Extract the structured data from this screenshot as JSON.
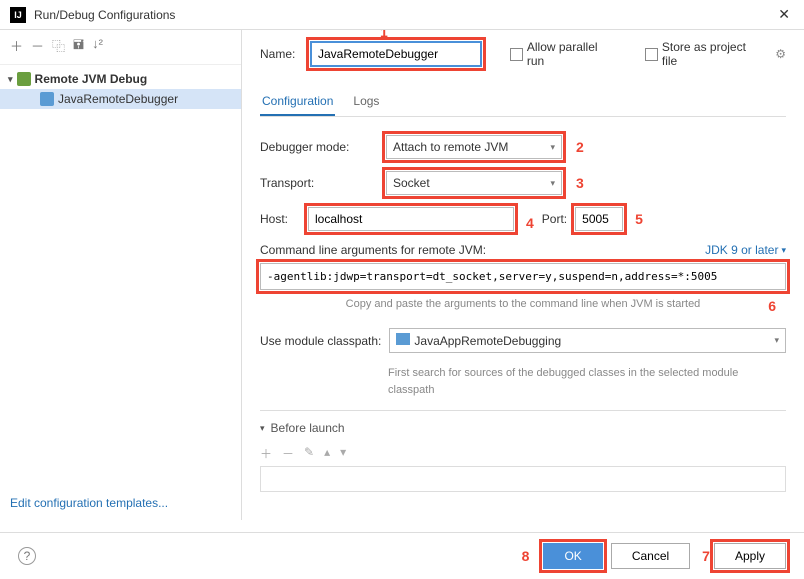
{
  "window": {
    "title": "Run/Debug Configurations"
  },
  "tree": {
    "root": "Remote JVM Debug",
    "child": "JavaRemoteDebugger"
  },
  "leftFooter": {
    "editTemplates": "Edit configuration templates..."
  },
  "form": {
    "nameLabel": "Name:",
    "nameValue": "JavaRemoteDebugger",
    "allowParallel": "Allow parallel run",
    "storeAsProject": "Store as project file"
  },
  "tabs": {
    "configuration": "Configuration",
    "logs": "Logs"
  },
  "config": {
    "debuggerModeLabel": "Debugger mode:",
    "debuggerModeValue": "Attach to remote JVM",
    "transportLabel": "Transport:",
    "transportValue": "Socket",
    "hostLabel": "Host:",
    "hostValue": "localhost",
    "portLabel": "Port:",
    "portValue": "5005",
    "cmdlineLabel": "Command line arguments for remote JVM:",
    "jdkLink": "JDK 9 or later",
    "cmdlineValue": "-agentlib:jdwp=transport=dt_socket,server=y,suspend=n,address=*:5005",
    "copyHelper": "Copy and paste the arguments to the command line when JVM is started",
    "classpathLabel": "Use module classpath:",
    "classpathValue": "JavaAppRemoteDebugging",
    "classpathHelper": "First search for sources of the debugged classes in the selected module classpath",
    "beforeLaunch": "Before launch"
  },
  "buttons": {
    "ok": "OK",
    "cancel": "Cancel",
    "apply": "Apply"
  },
  "annotations": {
    "a1": "1",
    "a2": "2",
    "a3": "3",
    "a4": "4",
    "a5": "5",
    "a6": "6",
    "a7": "7",
    "a8": "8"
  }
}
